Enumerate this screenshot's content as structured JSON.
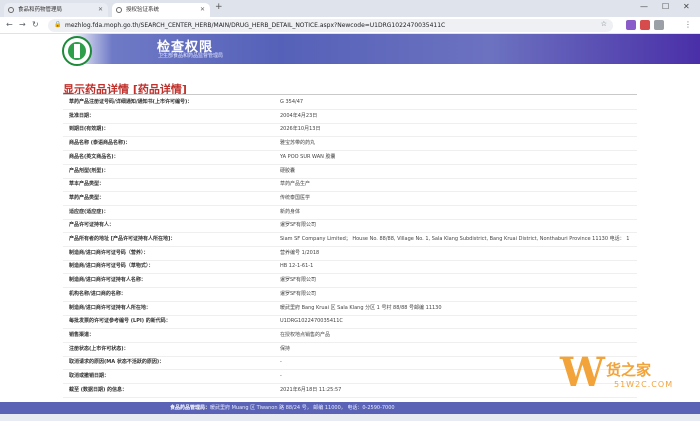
{
  "browser": {
    "tabs": [
      {
        "title": "食品和药物管理局"
      },
      {
        "title": "授权验证系统"
      }
    ],
    "url": "mezhlog.fda.moph.go.th/SEARCH_CENTER_HERB/MAIN/DRUG_HERB_DETAIL_NOTICE.aspx?Newcode=U1DRG1022470035411C"
  },
  "site": {
    "title": "检查权限",
    "subtitle": "卫生部食品和药品监督管理局"
  },
  "page": {
    "title": "显示药品详情 [药品详情]"
  },
  "fields": [
    {
      "label": "草药产品注册证号码/详细通知/通知书(上市许可编号)：",
      "value": "G 354/47"
    },
    {
      "label": "批准日期：",
      "value": "2004年4月23日"
    },
    {
      "label": "到期日(有效期)：",
      "value": "2026年10月13日"
    },
    {
      "label": "商品名称 (泰语商品名称)：",
      "value": "雅宝苏带的药丸"
    },
    {
      "label": "商品名(英文商品名)：",
      "value": "YA POO SUR WAN 胶囊"
    },
    {
      "label": "产品剂型(剂型)：",
      "value": "硬胶囊"
    },
    {
      "label": "草本产品类型：",
      "value": "草药产品生产"
    },
    {
      "label": "草药产品类型：",
      "value": "传统泰国医学"
    },
    {
      "label": "适应症(适应症)：",
      "value": "新药身体"
    },
    {
      "label": "产品许可证持有人：",
      "value": "暹罗SF有限公司"
    },
    {
      "label": "产品所有者的地址 [产品许可证持有人所在地]：",
      "value": "Siam SF Company Limited； House No. 88/88, Village No. 1, Sala Klang Subdistrict, Bang Kruai District, Nonthaburi Province 11130 电话： 11130 -"
    },
    {
      "label": "制造商/进口商许可证号码（营养）：",
      "value": "营养编号 1/2018"
    },
    {
      "label": "制造商/进口商许可证号码（草物式）：",
      "value": "HB 12-1-61-1"
    },
    {
      "label": "制造商/进口商许可证持有人名称：",
      "value": "暹罗SF有限公司"
    },
    {
      "label": "机构名称/进口商的名称：",
      "value": "暹罗SF有限公司"
    },
    {
      "label": "制造商/进口商许可证持有人所在地：",
      "value": "暖武里府 Bang Kruai 区 Sala Klang 分区 1 号村 88/88 号邮编 11130"
    },
    {
      "label": "每批发票的许可证参考编号 (LPI) 的新代码：",
      "value": "U1DRG1022470035411C"
    },
    {
      "label": "销售渠道：",
      "value": "在授权地点销售的产品"
    },
    {
      "label": "注册状态(上市许可状态)：",
      "value": "保持"
    },
    {
      "label": "取消请求的原因(MA 状态不活跃的原因)：",
      "value": "-"
    },
    {
      "label": "取消或撤销日期：",
      "value": "-"
    },
    {
      "label": "截至 (数据日期) 的信息：",
      "value": "2021年6月18日 11:25:57"
    }
  ],
  "footer": {
    "label": "食品药品管理局：",
    "text": "暖武里府 Muang 区 Tiwanon 路 88/24 号， 邮编 11000， 电话：0-2590-7000"
  },
  "watermark": {
    "letter": "W",
    "cn": "货之家",
    "en": "51W2C.COM"
  },
  "colors": {
    "header_accent": "#5561b8",
    "title_red": "#c0312c",
    "watermark_orange": "#f2a339"
  }
}
